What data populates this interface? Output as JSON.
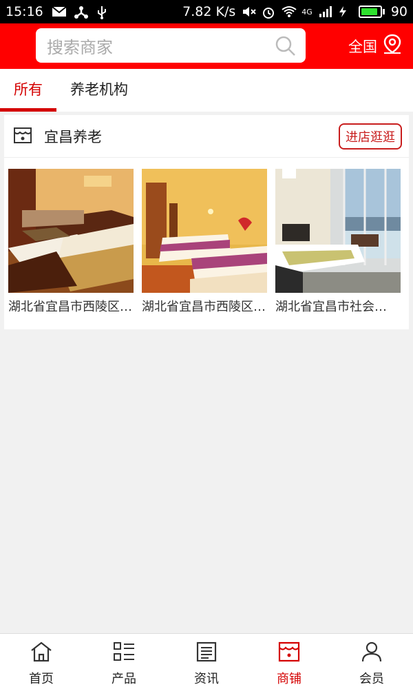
{
  "status_bar": {
    "time": "15:16",
    "speed": "7.82 K/s",
    "network": "4G",
    "battery": "90",
    "battery_level": 0.9
  },
  "header": {
    "search_placeholder": "搜索商家",
    "region_label": "全国"
  },
  "tabs": [
    {
      "label": "所有",
      "active": true
    },
    {
      "label": "养老机构",
      "active": false
    }
  ],
  "shop": {
    "name": "宜昌养老",
    "visit_label": "进店逛逛",
    "items": [
      {
        "caption": "湖北省宜昌市西陵区…"
      },
      {
        "caption": "湖北省宜昌市西陵区…"
      },
      {
        "caption": "湖北省宜昌市社会…"
      }
    ]
  },
  "bottom_nav": [
    {
      "label": "首页",
      "icon": "home-icon",
      "active": false
    },
    {
      "label": "产品",
      "icon": "grid-list-icon",
      "active": false
    },
    {
      "label": "资讯",
      "icon": "news-icon",
      "active": false
    },
    {
      "label": "商铺",
      "icon": "store-icon",
      "active": true
    },
    {
      "label": "会员",
      "icon": "user-icon",
      "active": false
    }
  ],
  "colors": {
    "brand": "#ff0000",
    "accent": "#d40000"
  }
}
